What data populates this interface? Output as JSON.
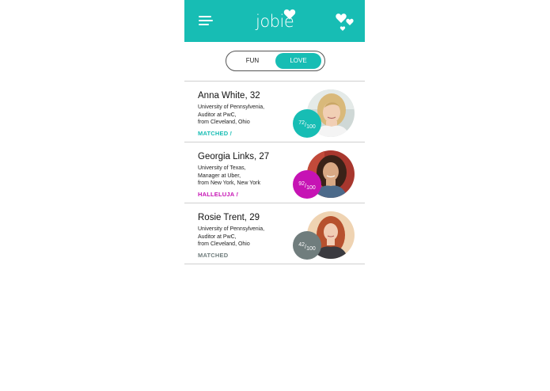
{
  "app": {
    "logo_text": "jobie"
  },
  "header": {
    "menu_icon": "hamburger-menu-icon",
    "right_icon": "hearts-icon"
  },
  "toggle": {
    "fun_label": "FUN",
    "love_label": "LOVE",
    "selected": "LOVE"
  },
  "colors": {
    "teal": "#17bdb4",
    "magenta": "#c613b4",
    "gray": "#707d7d"
  },
  "profiles": [
    {
      "name": "Anna White, 32",
      "line1": "University of Pennsylvenia,",
      "line2": "Auditor at PwC,",
      "line3": "from Cleveland, Ohio",
      "status": "MATCHED",
      "exclaim": "!",
      "score": "72",
      "score_total": "100"
    },
    {
      "name": "Georgia Links, 27",
      "line1": "University of Texas,",
      "line2": "Manager at Uber,",
      "line3": "from New York, New York",
      "status": "HALLELUJA",
      "exclaim": "!",
      "score": "92",
      "score_total": "100"
    },
    {
      "name": "Rosie Trent, 29",
      "line1": "University of Pennsylvenia,",
      "line2": "Auditor at PwC,",
      "line3": "from Cleveland, Ohio",
      "status": "MATCHED",
      "exclaim": "",
      "score": "42",
      "score_total": "100"
    }
  ]
}
